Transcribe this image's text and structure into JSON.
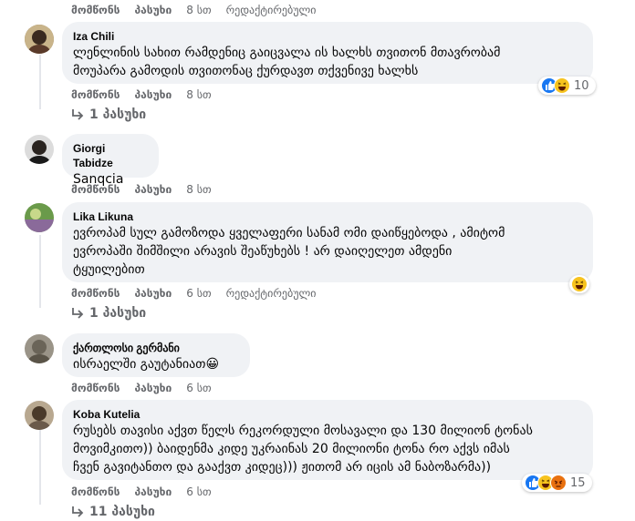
{
  "labels": {
    "like": "მომწონს",
    "reply": "პასუხი",
    "edited": "რედაქტირებული"
  },
  "top": {
    "time": "8 სთ"
  },
  "comments": [
    {
      "author": "Iza Chili",
      "text": "ლენლინის სახით რამდენიც გაიცვალა ის ხალხს თვითონ მთავრობამ\nმოუპარა გამოდის თვითონაც ქურდავთ თქვენივე ხალხს",
      "time": "8 სთ",
      "reactions": "10",
      "replies": "1 პასუხი"
    },
    {
      "author": "Giorgi Tabidze",
      "text": "Sanqcia",
      "time": "8 სთ"
    },
    {
      "author": "Lika Likuna",
      "text": "ევროპამ სულ გამოზოდა ყველაფერი სანამ ომი დაიწყებოდა , ამიტომ\nევროპაში შიმშილი არავის შეაწუხებს ! არ დაიღელეთ ამდენი\nტყუილებით",
      "time": "6 სთ",
      "replies": "1 პასუხი"
    },
    {
      "author": "ქართლოსი გერმანი",
      "text": "ისრაელში გაუტანიათ😀",
      "time": "6 სთ"
    },
    {
      "author": "Koba Kutelia",
      "text": "რუსებს თავისი აქვთ წელს რეკორდული მოსავალი და 130 მილიონ ტონას\nმოვიმკითო)) ბაიდენმა კიდე უკრაინას 20 მილიონი ტონა რო აქვს იმას\nჩვენ გავიტანთო და გააქვთ კიდეც))) ჟითომ არ იცის ამ ნაბოზარმა))",
      "time": "6 სთ",
      "reactions": "15",
      "replies": "11 პასუხი"
    }
  ]
}
